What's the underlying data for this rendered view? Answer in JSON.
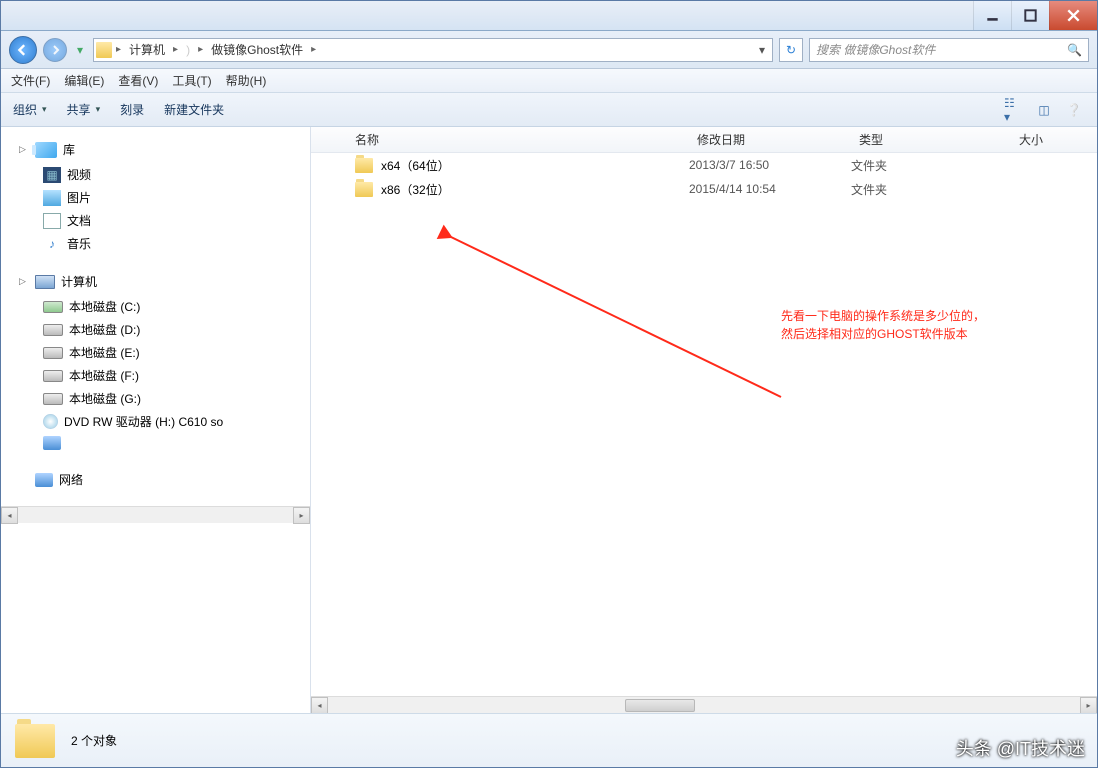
{
  "titlebar": {},
  "address": {
    "segments": [
      "计算机",
      "",
      "做镜像Ghost软件"
    ],
    "hidden_segment": "  )"
  },
  "search": {
    "placeholder": "搜索 做镜像Ghost软件"
  },
  "menubar": {
    "file": "文件(F)",
    "edit": "编辑(E)",
    "view": "查看(V)",
    "tools": "工具(T)",
    "help": "帮助(H)"
  },
  "toolbar": {
    "organize": "组织",
    "share": "共享",
    "burn": "刻录",
    "new_folder": "新建文件夹"
  },
  "sidebar": {
    "library": {
      "label": "库",
      "items": [
        {
          "label": "视频",
          "icon": "video"
        },
        {
          "label": "图片",
          "icon": "picture"
        },
        {
          "label": "文档",
          "icon": "document"
        },
        {
          "label": "音乐",
          "icon": "music"
        }
      ]
    },
    "computer": {
      "label": "计算机",
      "items": [
        {
          "label": "本地磁盘 (C:)",
          "icon": "drive-c"
        },
        {
          "label": "本地磁盘 (D:)",
          "icon": "drive"
        },
        {
          "label": "本地磁盘 (E:)",
          "icon": "drive"
        },
        {
          "label": "本地磁盘 (F:)",
          "icon": "drive"
        },
        {
          "label": "本地磁盘 (G:)",
          "icon": "drive"
        },
        {
          "label": "DVD RW 驱动器 (H:) C610 so",
          "icon": "dvd"
        },
        {
          "label": "",
          "icon": "net"
        }
      ]
    },
    "network": {
      "label": "网络"
    }
  },
  "columns": {
    "name": "名称",
    "date": "修改日期",
    "type": "类型",
    "size": "大小"
  },
  "rows": [
    {
      "name": "x64（64位）",
      "date": "2013/3/7 16:50",
      "type": "文件夹"
    },
    {
      "name": "x86（32位）",
      "date": "2015/4/14 10:54",
      "type": "文件夹"
    }
  ],
  "annotation": {
    "line1": "先看一下电脑的操作系统是多少位的，",
    "line2": "然后选择相对应的GHOST软件版本"
  },
  "statusbar": {
    "count_text": "2 个对象"
  },
  "watermark": "头条 @IT技术迷"
}
